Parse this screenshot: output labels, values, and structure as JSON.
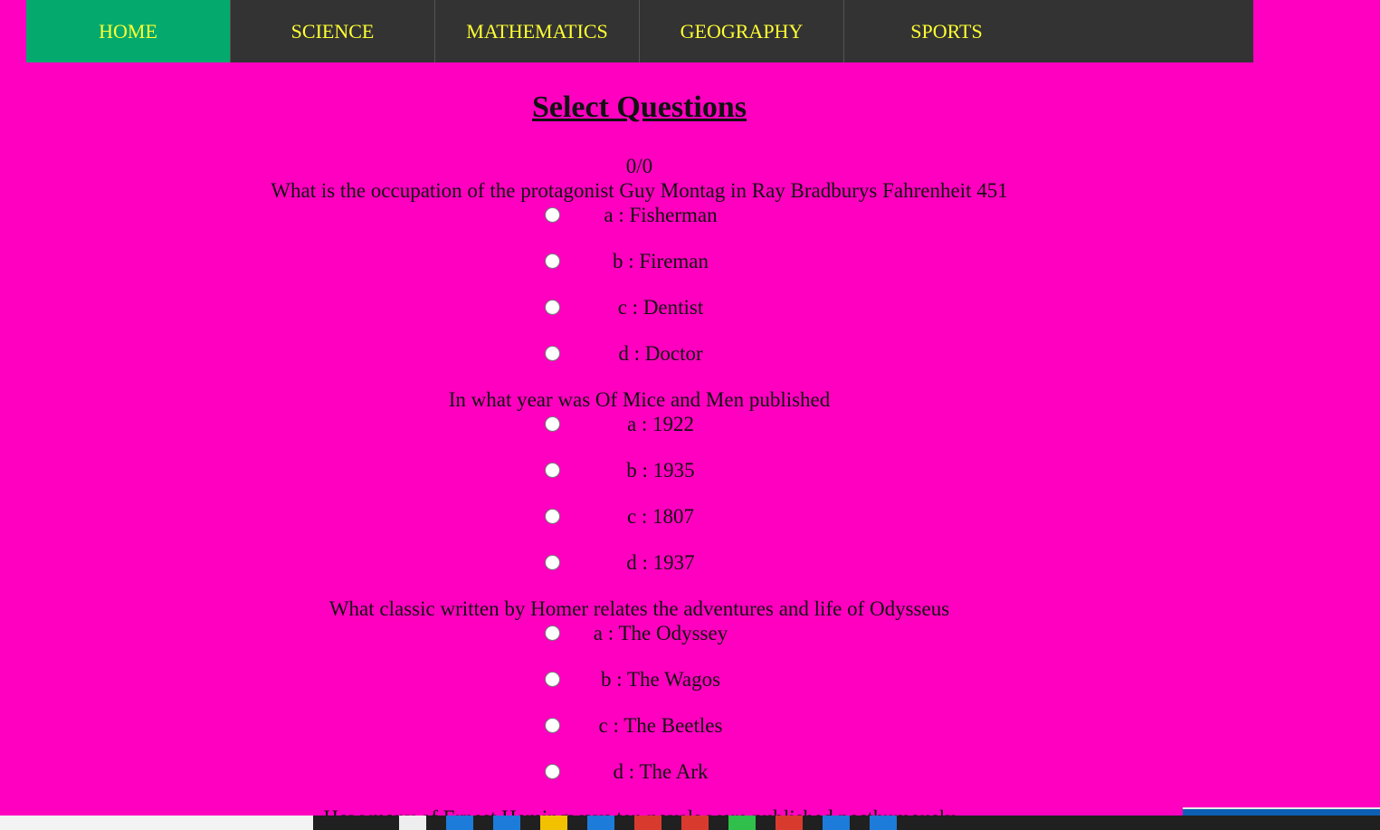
{
  "nav": {
    "items": [
      {
        "label": "HOME"
      },
      {
        "label": "SCIENCE"
      },
      {
        "label": "MATHEMATICS"
      },
      {
        "label": "GEOGRAPHY"
      },
      {
        "label": "SPORTS"
      }
    ],
    "active_index": 0,
    "active_color": "#04aa6d",
    "text_color": "#ffff33",
    "bg_color": "#333333"
  },
  "page": {
    "title": "Select Questions",
    "score": "0/0",
    "background": "#ff00c0"
  },
  "questions": [
    {
      "text": "What is the occupation of the protagonist Guy Montag in Ray Bradburys Fahrenheit 451",
      "options": [
        {
          "label": "a : Fisherman"
        },
        {
          "label": "b : Fireman"
        },
        {
          "label": "c : Dentist"
        },
        {
          "label": "d : Doctor"
        }
      ]
    },
    {
      "text": "In what year was Of Mice and Men published",
      "options": [
        {
          "label": "a : 1922"
        },
        {
          "label": "b : 1935"
        },
        {
          "label": "c : 1807"
        },
        {
          "label": "d : 1937"
        }
      ]
    },
    {
      "text": "What classic written by Homer relates the adventures and life of Odysseus",
      "options": [
        {
          "label": "a : The Odyssey"
        },
        {
          "label": "b : The Wagos"
        },
        {
          "label": "c : The Beetles"
        },
        {
          "label": "d : The Ark"
        }
      ]
    },
    {
      "text": "How many of Ernest Hemingways ten novels were published posthumously",
      "options": []
    }
  ]
}
